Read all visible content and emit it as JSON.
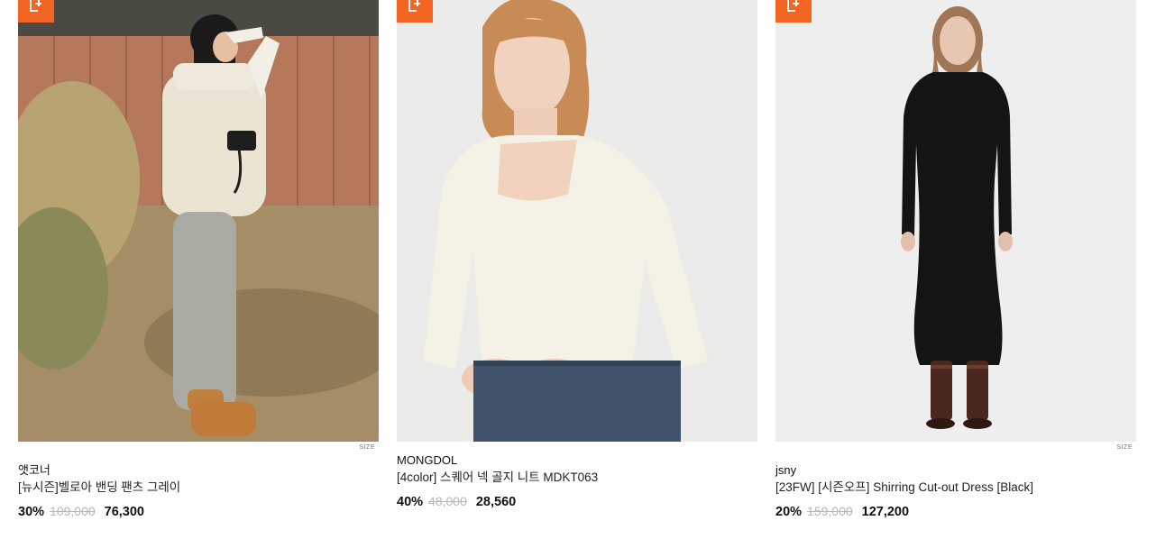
{
  "products": [
    {
      "brand": "앳코너",
      "name": "[뉴시즌]벨로아 밴딩 팬츠 그레이",
      "discount": "30%",
      "original_price": "109,000",
      "sale_price": "76,300",
      "size_label": "SIZE",
      "show_size": true,
      "image": "woman-in-fleece-vest-outdoor-photo"
    },
    {
      "brand": "MONGDOL",
      "name": "[4color] 스퀘어 넥 골지 니트 MDKT063",
      "discount": "40%",
      "original_price": "48,000",
      "sale_price": "28,560",
      "size_label": "",
      "show_size": false,
      "image": "woman-in-white-knit-photo"
    },
    {
      "brand": "jsny",
      "name": "[23FW] [시즌오프] Shirring Cut-out Dress [Black]",
      "discount": "20%",
      "original_price": "159,000",
      "sale_price": "127,200",
      "size_label": "SIZE",
      "show_size": true,
      "image": "woman-in-black-dress-photo"
    }
  ],
  "colors": {
    "badge": "#f26522",
    "original_price": "#b8b8b8",
    "text": "#111111"
  }
}
